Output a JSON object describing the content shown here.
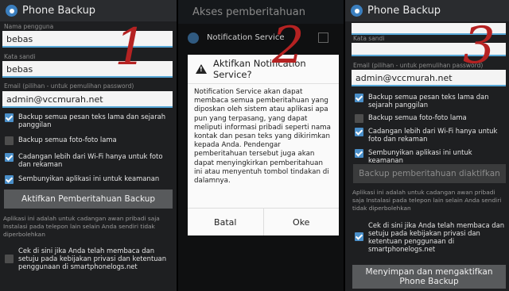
{
  "panel1": {
    "title": "Phone Backup",
    "username_label": "Nama pengguna",
    "username_value": "bebas",
    "password_label": "Kata sandi",
    "password_value": "bebas",
    "email_label": "Email (pilihan - untuk pemulihan password)",
    "email_value": "admin@vccmurah.net",
    "options": [
      {
        "label": "Backup semua pesan teks lama dan sejarah panggilan",
        "checked": true
      },
      {
        "label": "Backup semua foto-foto lama",
        "checked": false
      },
      {
        "label": "Cadangan lebih dari Wi-Fi hanya untuk foto dan rekaman",
        "checked": true
      },
      {
        "label": "Sembunyikan aplikasi ini untuk keamanan",
        "checked": true
      }
    ],
    "button": "Aktifkan Pemberitahuan Backup",
    "info": "Aplikasi ini adalah untuk cadangan awan pribadi saja Instalasi pada telepon lain selain Anda sendiri tidak diperbolehkan",
    "agree": "Cek di sini jika Anda telah membaca dan setuju pada kebijakan privasi dan ketentuan penggunaan di smartphonelogs.net",
    "agree_checked": false,
    "step": "1"
  },
  "panel2": {
    "title": "Akses pemberitahuan",
    "service": "Notification Service",
    "dialog_title": "Aktifkan Notification Service?",
    "dialog_body": "Notification Service akan dapat membaca semua pemberitahuan yang diposkan oleh sistem atau aplikasi apa pun yang terpasang, yang dapat meliputi informasi pribadi seperti nama kontak dan pesan teks yang dikirimkan kepada Anda. Pendengar pemberitahuan tersebut juga akan dapat menyingkirkan pemberitahuan ini atau menyentuh tombol tindakan di dalamnya.",
    "cancel": "Batal",
    "ok": "Oke",
    "step": "2"
  },
  "panel3": {
    "title": "Phone Backup",
    "password_label": "Kata sandi",
    "email_label": "Email (pilihan - untuk pemulihan password)",
    "email_value": "admin@vccmurah.net",
    "options": [
      {
        "label": "Backup semua pesan teks lama dan sejarah panggilan",
        "checked": true
      },
      {
        "label": "Backup semua foto-foto lama",
        "checked": false
      },
      {
        "label": "Cadangan lebih dari Wi-Fi hanya untuk foto dan rekaman",
        "checked": true
      },
      {
        "label": "Sembunyikan aplikasi ini untuk keamanan",
        "checked": true
      }
    ],
    "disabled_button": "Backup pemberitahuan diaktifkan",
    "info": "Aplikasi ini adalah untuk cadangan awan pribadi saja Instalasi pada telepon lain selain Anda sendiri tidak diperbolehkan",
    "agree": "Cek di sini jika Anda telah membaca dan setuju pada kebijakan privasi dan ketentuan penggunaan di smartphonelogs.net",
    "agree_checked": true,
    "save_button": "Menyimpan dan mengaktifkan Phone Backup",
    "step": "3"
  }
}
